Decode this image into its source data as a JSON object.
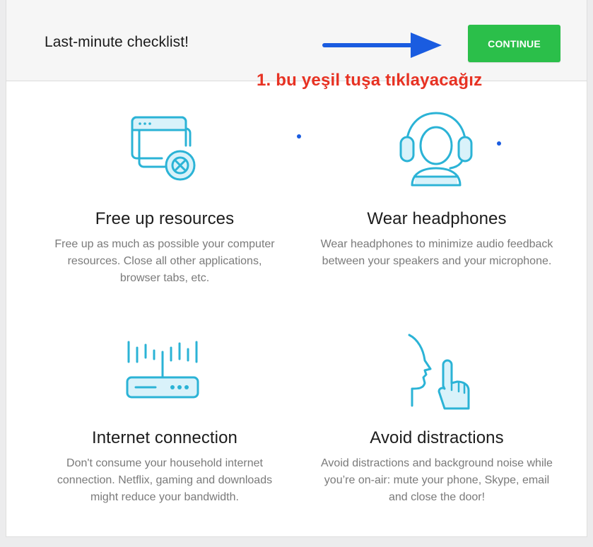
{
  "header": {
    "title": "Last-minute checklist!",
    "continue_label": "CONTINUE"
  },
  "annotation": {
    "text": "1. bu yeşil tuşa tıklayacağız",
    "color": "#e73223"
  },
  "colors": {
    "button_green": "#2bbf4a",
    "arrow_blue": "#1a5ce0",
    "icon_teal": "#2bb3d6",
    "icon_fill": "#d9f2fa"
  },
  "items": [
    {
      "icon": "browser-close-icon",
      "title": "Free up resources",
      "description": "Free up as much as possible your computer resources. Close all other applications, browser tabs, etc."
    },
    {
      "icon": "headphones-icon",
      "title": "Wear headphones",
      "description": "Wear headphones to minimize audio feedback between your speakers and your microphone."
    },
    {
      "icon": "router-icon",
      "title": "Internet connection",
      "description": "Don't consume your household internet connection. Netflix, gaming and downloads might reduce your bandwidth."
    },
    {
      "icon": "quiet-gesture-icon",
      "title": "Avoid distractions",
      "description": "Avoid distractions and background noise while you’re on-air: mute your phone, Skype, email and close the door!"
    }
  ]
}
